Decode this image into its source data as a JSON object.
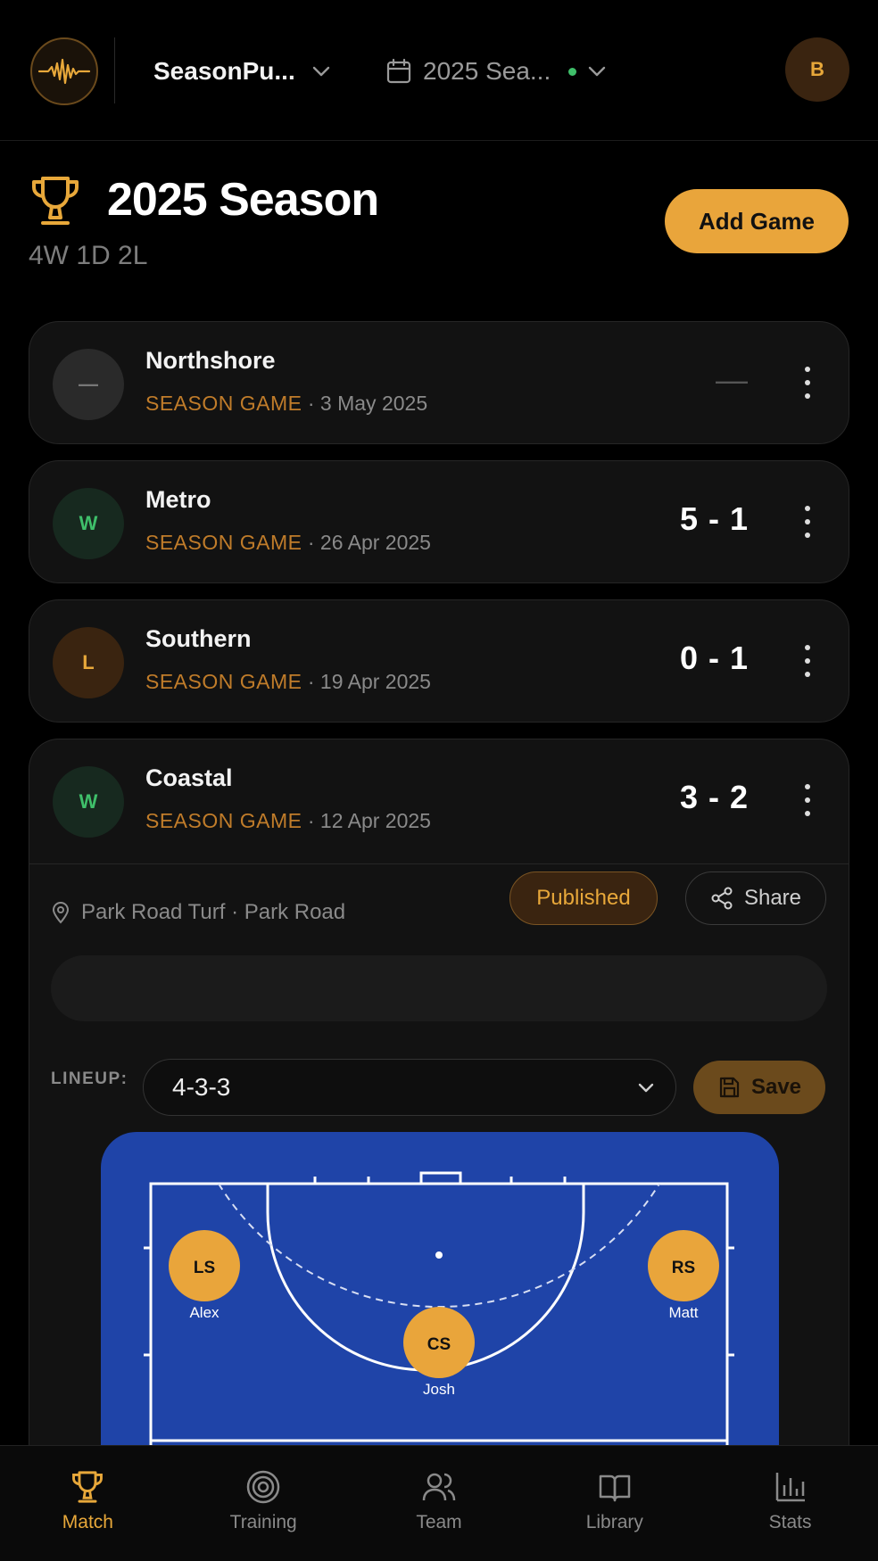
{
  "header": {
    "team_name": "SeasonPu...",
    "season_name": "2025 Sea...",
    "avatar_initial": "B"
  },
  "season": {
    "title": "2025 Season",
    "record": "4W 1D 2L",
    "add_game_label": "Add Game"
  },
  "games": [
    {
      "result": "—",
      "opponent": "Northshore",
      "type": "SEASON GAME",
      "date": "· 3 May 2025",
      "score": "—"
    },
    {
      "result": "W",
      "opponent": "Metro",
      "type": "SEASON GAME",
      "date": "· 26 Apr 2025",
      "score": "5 - 1"
    },
    {
      "result": "L",
      "opponent": "Southern",
      "type": "SEASON GAME",
      "date": "· 19 Apr 2025",
      "score": "0 - 1"
    },
    {
      "result": "W",
      "opponent": "Coastal",
      "type": "SEASON GAME",
      "date": "· 12 Apr 2025",
      "score": "3 - 2"
    }
  ],
  "expanded": {
    "venue": "Park Road Turf · Park Road",
    "status": "Published",
    "share_label": "Share",
    "lineup_label": "LINEUP:",
    "lineup_value": "4-3-3",
    "save_label": "Save",
    "players": [
      {
        "pos": "LS",
        "name": "Alex"
      },
      {
        "pos": "CS",
        "name": "Josh"
      },
      {
        "pos": "RS",
        "name": "Matt"
      }
    ]
  },
  "nav": [
    {
      "label": "Match",
      "active": true
    },
    {
      "label": "Training",
      "active": false
    },
    {
      "label": "Team",
      "active": false
    },
    {
      "label": "Library",
      "active": false
    },
    {
      "label": "Stats",
      "active": false
    }
  ],
  "colors": {
    "accent": "#e9a53b",
    "win": "#3fbf6a",
    "pitch": "#1f44a8",
    "card": "#121212"
  }
}
